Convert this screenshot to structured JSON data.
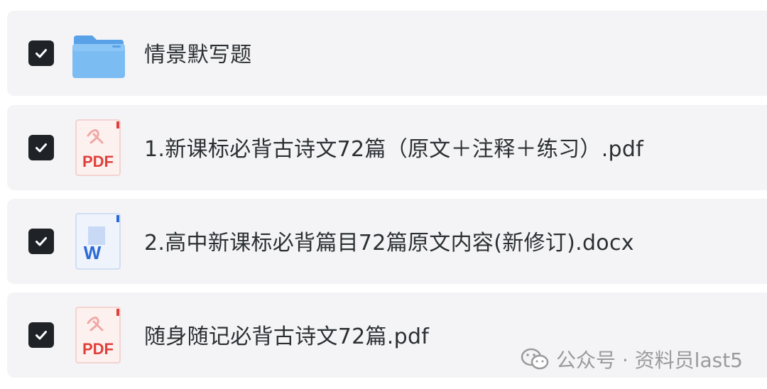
{
  "files": [
    {
      "name": "情景默写题",
      "type": "folder",
      "icon": "folder-icon",
      "checked": true
    },
    {
      "name": "1.新课标必背古诗文72篇（原文＋注释＋练习）.pdf",
      "type": "pdf",
      "icon": "pdf-file-icon",
      "icon_label": "PDF",
      "checked": true
    },
    {
      "name": "2.高中新课标必背篇目72篇原文内容(新修订).docx",
      "type": "docx",
      "icon": "word-file-icon",
      "icon_label": "W",
      "checked": true
    },
    {
      "name": "随身随记必背古诗文72篇.pdf",
      "type": "pdf",
      "icon": "pdf-file-icon",
      "icon_label": "PDF",
      "checked": true
    }
  ],
  "watermark": {
    "icon": "wechat-icon",
    "text": "公众号 · 资料员last5"
  },
  "colors": {
    "row_background": "#f4f4f6",
    "checkbox": "#1f2328",
    "folder": "#6fb3f0",
    "pdf_accent": "#e0403a",
    "word_accent": "#2b6ad6",
    "text": "#2b2f33",
    "watermark": "#9a9a9a"
  }
}
